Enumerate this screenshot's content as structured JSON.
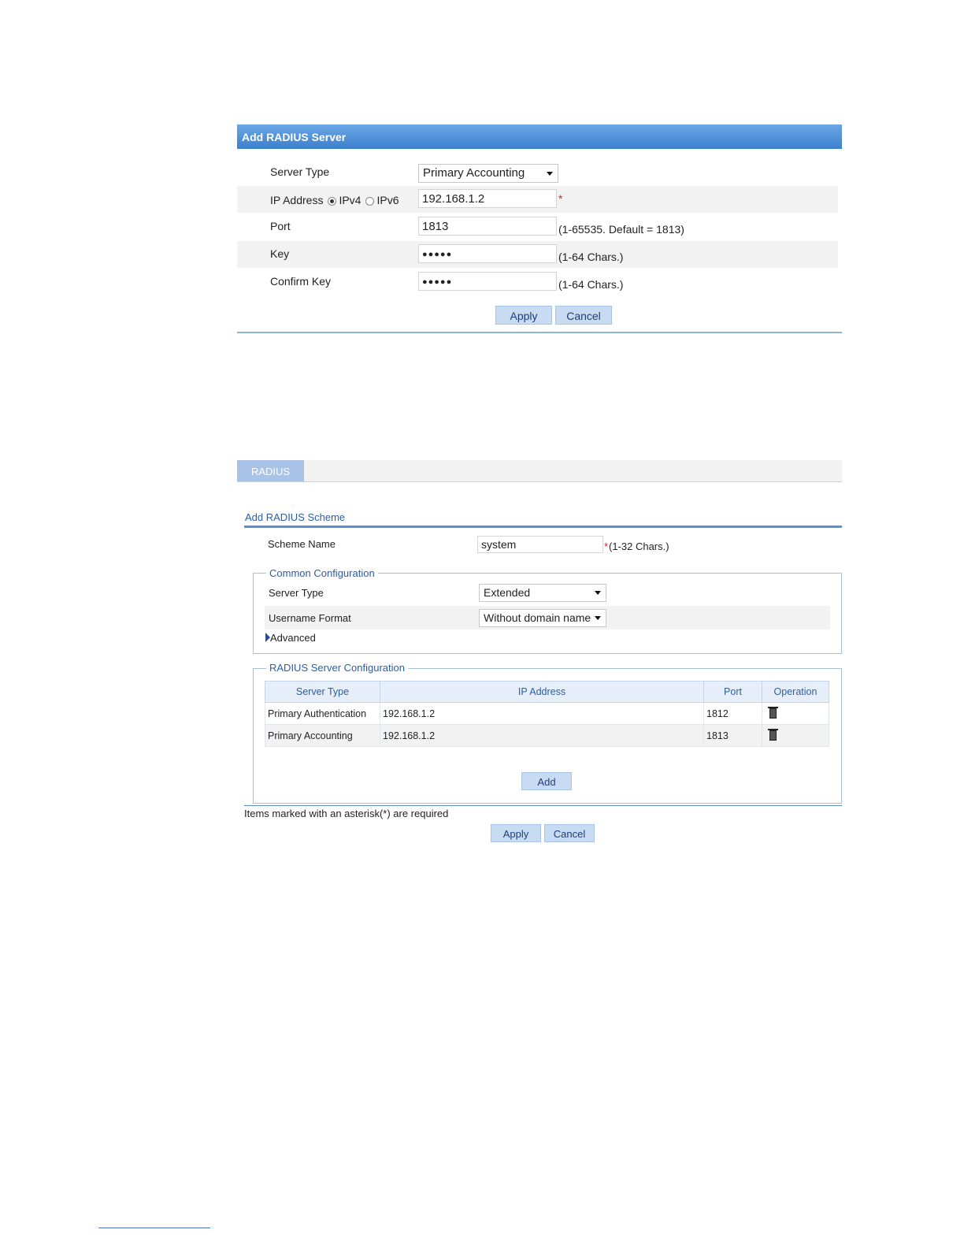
{
  "dialog": {
    "title": "Add RADIUS Server",
    "server_type": {
      "label": "Server Type",
      "value": "Primary Accounting"
    },
    "ip_address": {
      "label": "IP Address",
      "ipv4": "IPv4",
      "ipv6": "IPv6",
      "selected": "IPv4",
      "value": "192.168.1.2",
      "required": "*"
    },
    "port": {
      "label": "Port",
      "value": "1813",
      "hint": "(1-65535. Default = 1813)"
    },
    "key": {
      "label": "Key",
      "value": "●●●●●",
      "hint": "(1-64 Chars.)"
    },
    "confirm_key": {
      "label": "Confirm Key",
      "value": "●●●●●",
      "hint": "(1-64 Chars.)"
    },
    "apply": "Apply",
    "cancel": "Cancel"
  },
  "page": {
    "tab": "RADIUS",
    "section_title": "Add RADIUS Scheme",
    "scheme_name": {
      "label": "Scheme Name",
      "value": "system",
      "required": "*",
      "hint": "(1-32 Chars.)"
    },
    "common": {
      "legend": "Common Configuration",
      "server_type": {
        "label": "Server Type",
        "value": "Extended"
      },
      "username_format": {
        "label": "Username Format",
        "value": "Without domain name"
      },
      "advanced": "Advanced"
    },
    "servers": {
      "legend": "RADIUS Server Configuration",
      "columns": [
        "Server Type",
        "IP Address",
        "Port",
        "Operation"
      ],
      "rows": [
        {
          "server_type": "Primary Authentication",
          "ip": "192.168.1.2",
          "port": "1812"
        },
        {
          "server_type": "Primary Accounting",
          "ip": "192.168.1.2",
          "port": "1813"
        }
      ],
      "add": "Add"
    },
    "required_note": "Items marked with an asterisk(*) are required",
    "apply": "Apply",
    "cancel": "Cancel"
  },
  "colors": {
    "header_blue": "#3b7fcc",
    "button_bg": "#c7dbf2",
    "accent_text": "#2a5da8",
    "required": "#e02020"
  }
}
